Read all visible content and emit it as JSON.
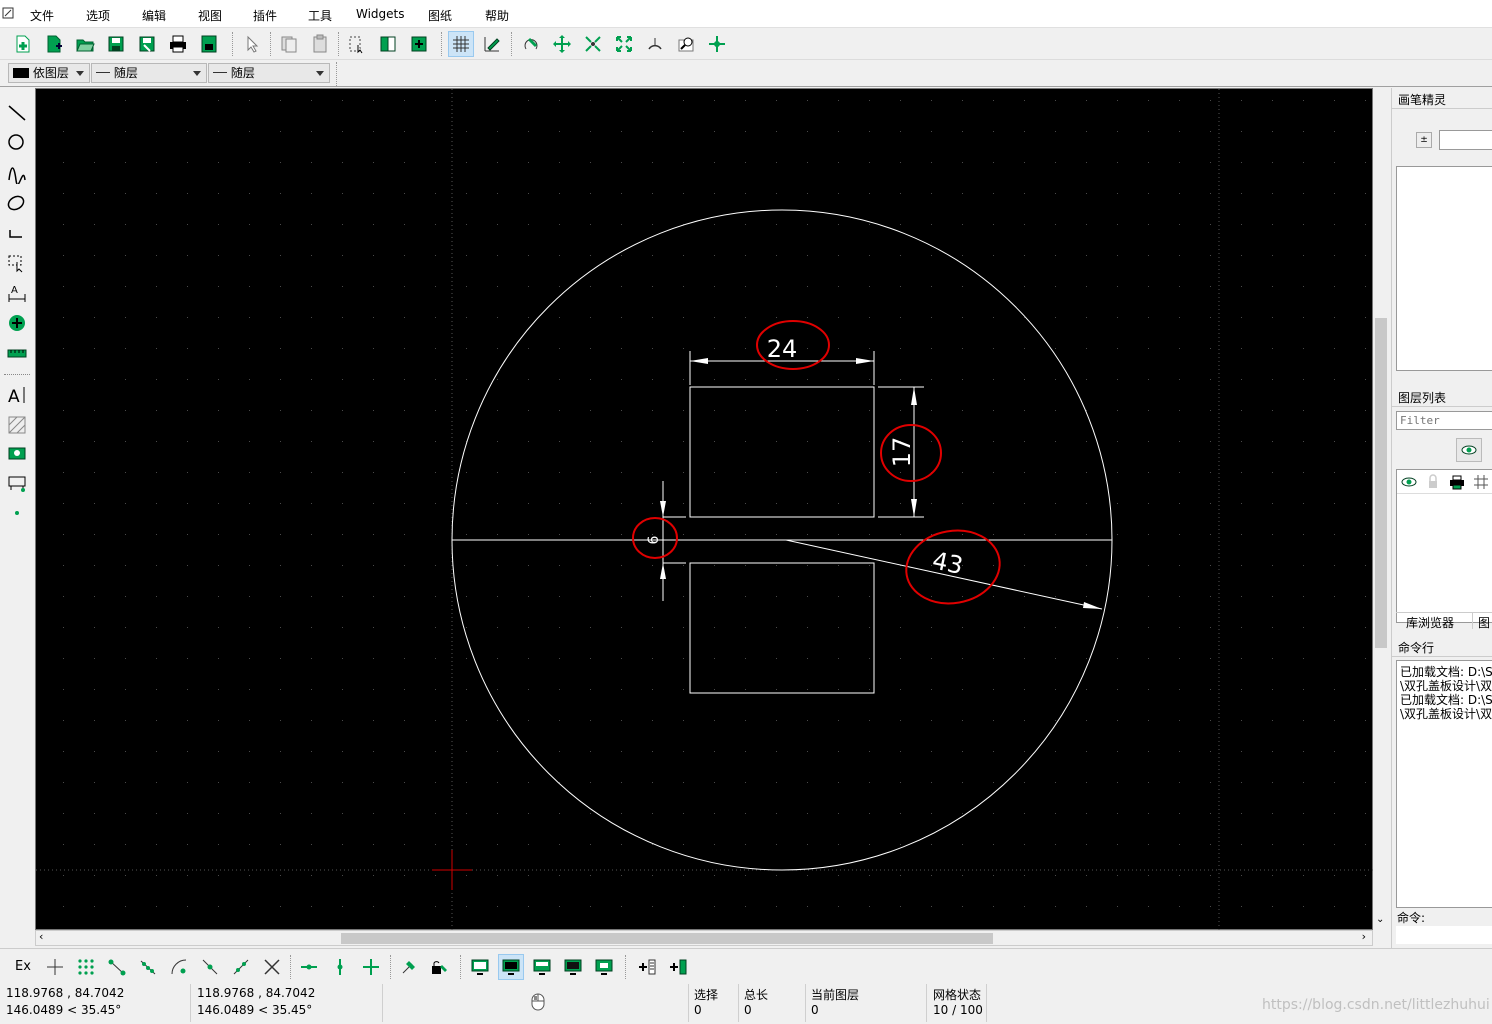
{
  "menu": [
    "文件",
    "选项",
    "编辑",
    "视图",
    "插件",
    "工具",
    "Widgets",
    "图纸",
    "帮助"
  ],
  "layer_bar": {
    "color_label": "依图层",
    "linetype_label": "随层",
    "linewidth_label": "随层"
  },
  "canvas": {
    "dimensions": {
      "width": "24",
      "height": "17",
      "gap": "6",
      "radius": "43"
    }
  },
  "right_panel": {
    "pen_title": "画笔精灵",
    "layer_title": "图层列表",
    "filter_placeholder": "Filter",
    "tabs": [
      "库浏览器",
      "图"
    ],
    "cmd_title": "命令行",
    "cmd_lines": [
      "已加载文档: D:\\S",
      "\\双孔盖板设计\\双",
      "已加载文档: D:\\S",
      "\\双孔盖板设计\\双"
    ],
    "cmd_prompt": "命令:"
  },
  "snap_label": "Ex",
  "status": {
    "abs_coord": "118.9768 , 84.7042",
    "abs_polar": "146.0489 < 35.45°",
    "rel_coord": "118.9768 , 84.7042",
    "rel_polar": "146.0489 < 35.45°",
    "select_label": "选择",
    "select_value": "0",
    "total_label": "总长",
    "total_value": "0",
    "layer_label": "当前图层",
    "layer_value": "0",
    "grid_label": "网格状态",
    "grid_value": "10 / 100"
  },
  "watermark": "https://blog.csdn.net/littlezhuhui",
  "colors": {
    "canvas_bg": "#000000",
    "entity": "#ffffff",
    "annotation": "#e00000",
    "icon_green": "#00a050"
  }
}
